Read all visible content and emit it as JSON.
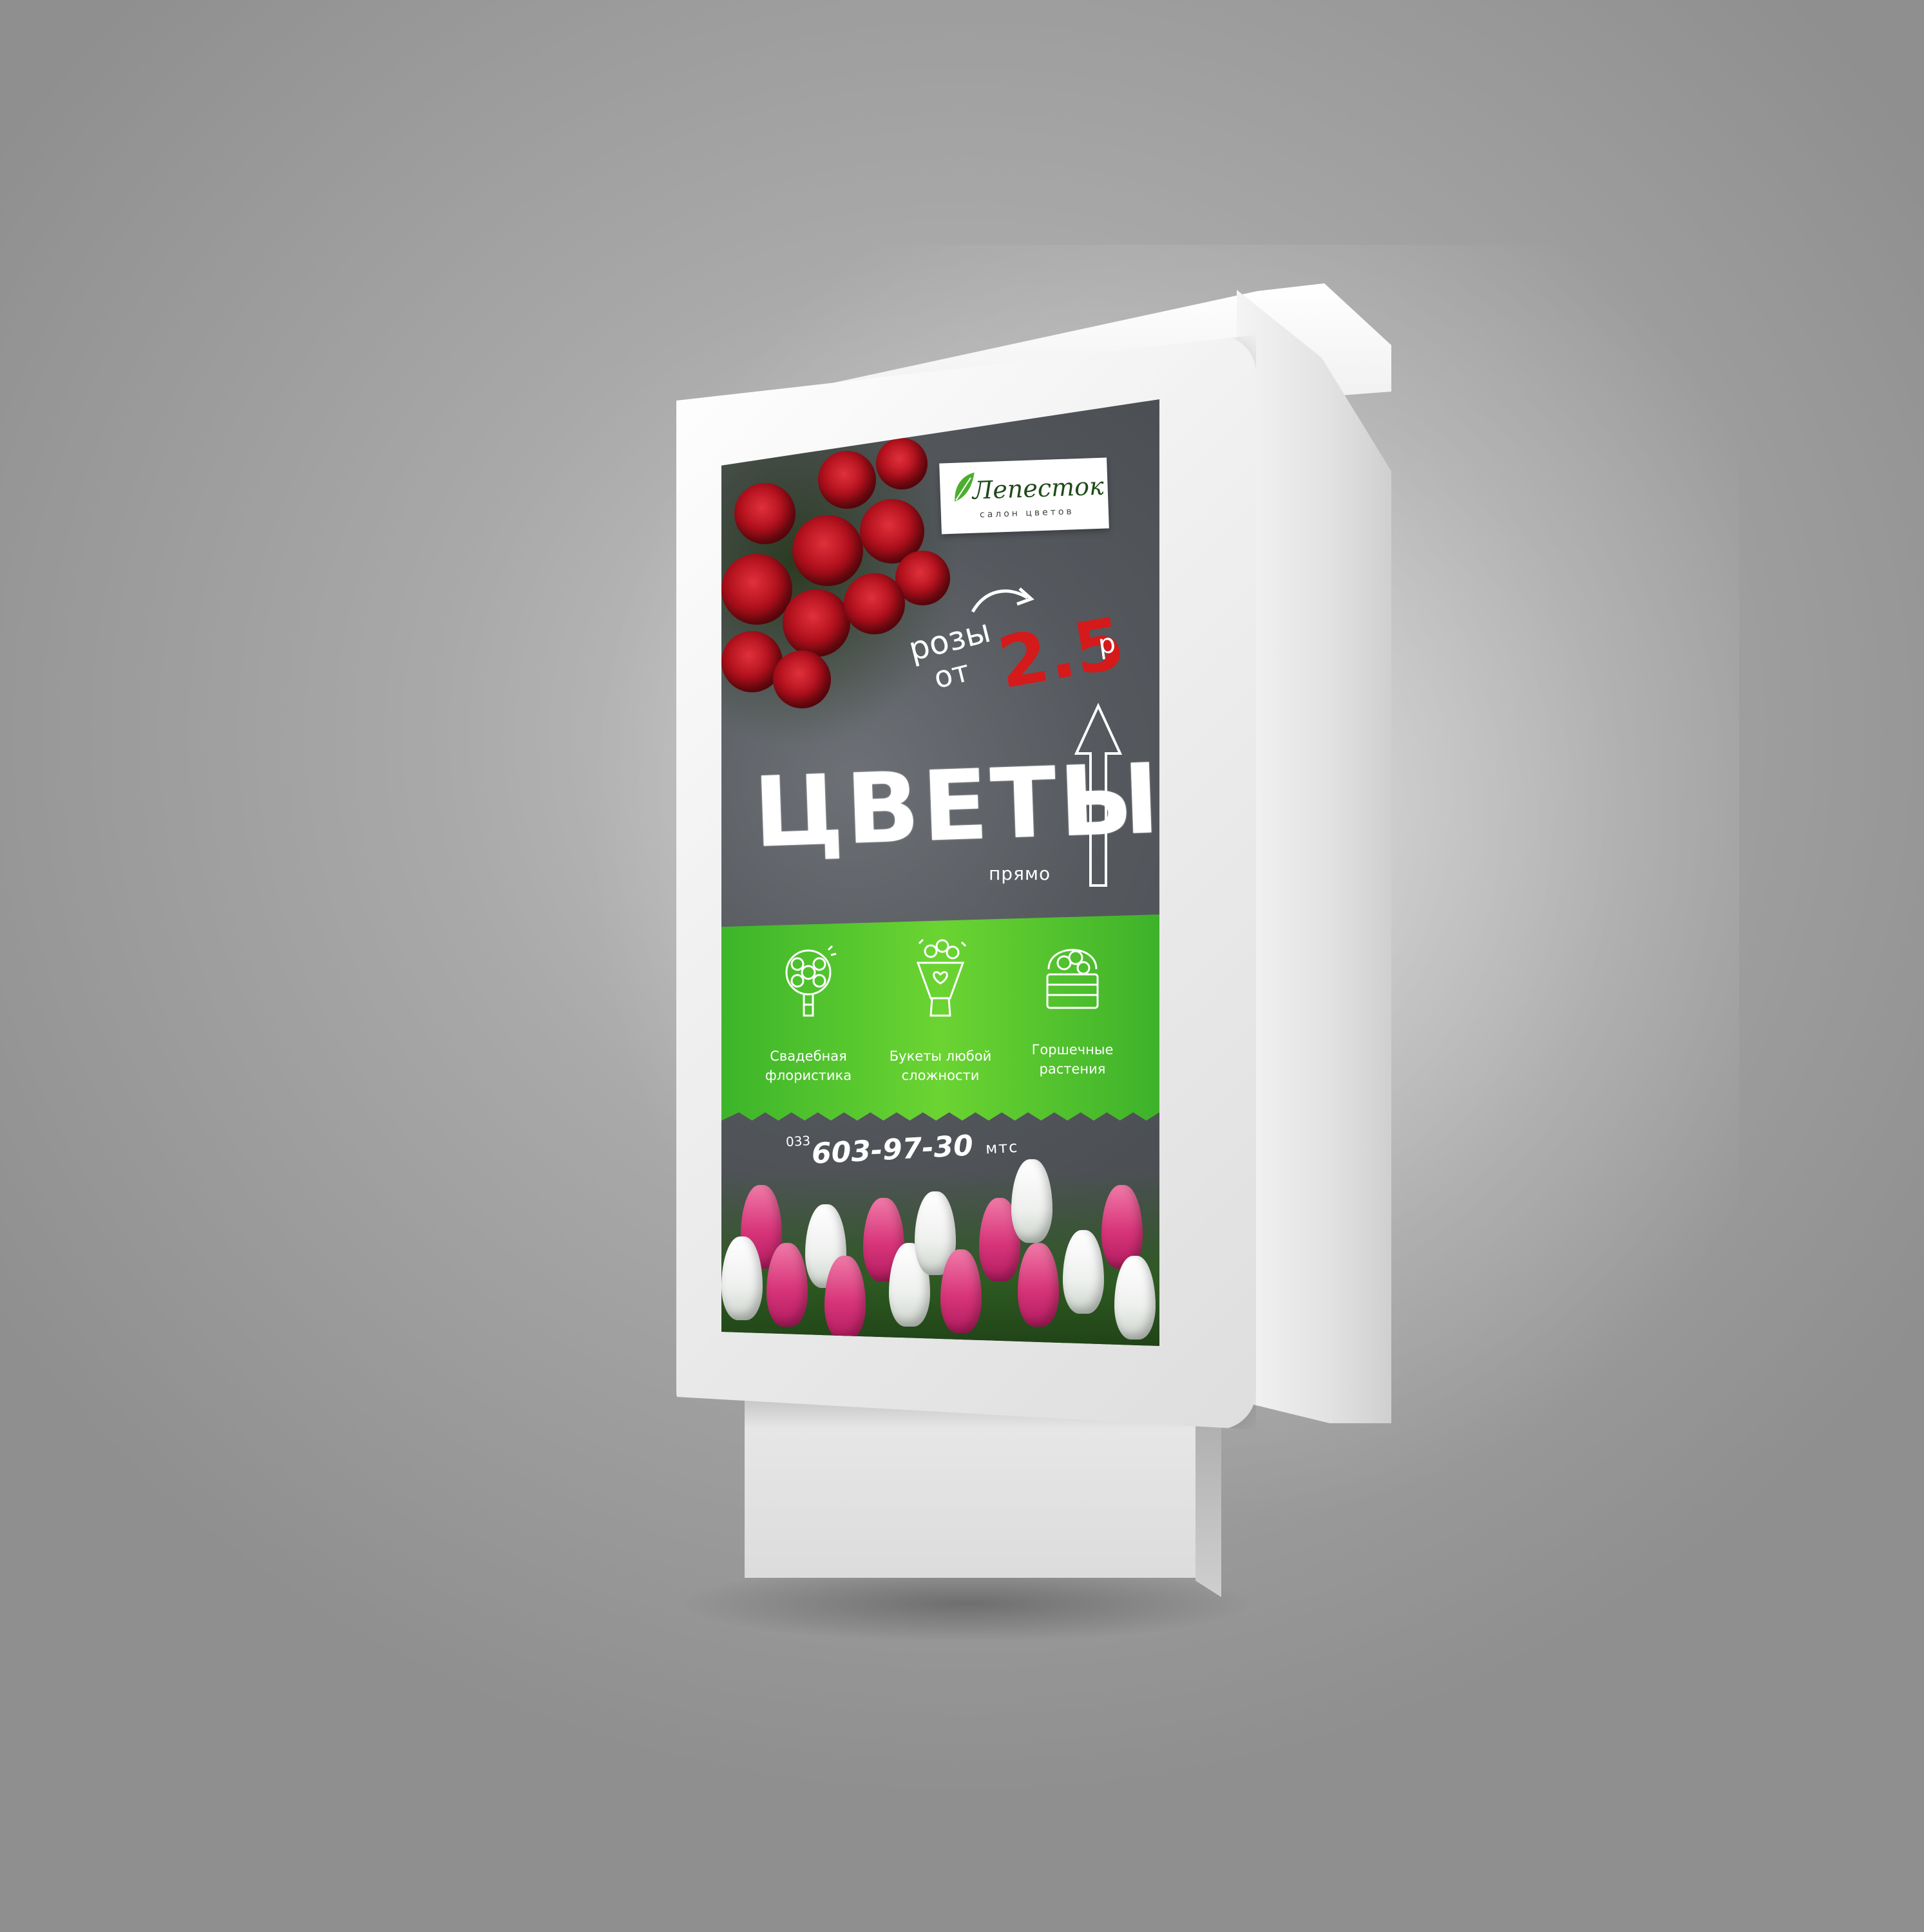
{
  "poster": {
    "logo": {
      "name": "Лепесток",
      "subtitle": "салон цветов"
    },
    "promo": {
      "line1": "розы",
      "line2": "от",
      "price": "2.5",
      "currency": "р"
    },
    "title": "ЦВЕТЫ",
    "direction": "прямо",
    "services": [
      {
        "icon": "wedding-bouquet-icon",
        "label": "Свадебная\nфлористика"
      },
      {
        "icon": "bouquet-icon",
        "label": "Букеты любой\nсложности"
      },
      {
        "icon": "potted-plant-basket-icon",
        "label": "Горшечные\nрастения"
      }
    ],
    "phone": {
      "prefix": "033",
      "number": "603-97-30",
      "operator": "мтс"
    }
  },
  "colors": {
    "band_green": "#56c92e",
    "price_red": "#d41a1a",
    "background_gray": "#a9a9a9"
  }
}
